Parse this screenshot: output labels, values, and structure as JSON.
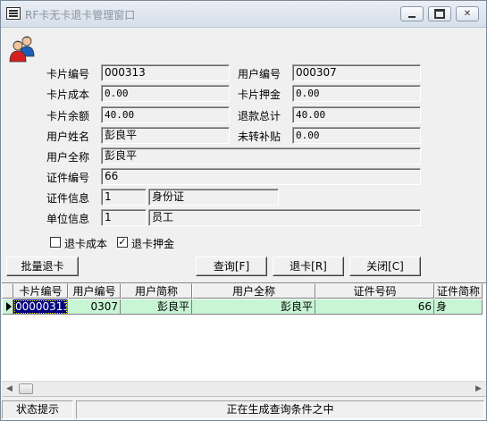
{
  "window": {
    "title": "RF卡无卡退卡管理窗口"
  },
  "icons": {
    "app": "window-menu-icon",
    "users": "users-icon"
  },
  "form": {
    "card_no_label": "卡片编号",
    "card_no": "000313",
    "user_no_label": "用户编号",
    "user_no": "000307",
    "card_cost_label": "卡片成本",
    "card_cost": "0.00",
    "card_deposit_label": "卡片押金",
    "card_deposit": "0.00",
    "card_balance_label": "卡片余额",
    "card_balance": "40.00",
    "refund_total_label": "退款总计",
    "refund_total": "40.00",
    "user_name_label": "用户姓名",
    "user_name": "彭良平",
    "untransferred_label": "未转补贴",
    "untransferred": "0.00",
    "full_name_label": "用户全称",
    "full_name": "彭良平",
    "id_no_label": "证件编号",
    "id_no": "66",
    "id_info_label": "证件信息",
    "id_info_code": "1",
    "id_info_name": "身份证",
    "unit_info_label": "单位信息",
    "unit_info_code": "1",
    "unit_info_name": "员工"
  },
  "options": {
    "refund_cost_label": "退卡成本",
    "refund_cost_checked": false,
    "refund_deposit_label": "退卡押金",
    "refund_deposit_checked": true
  },
  "buttons": {
    "batch_refund": "批量退卡",
    "query": "查询[F]",
    "refund": "退卡[R]",
    "close": "关闭[C]"
  },
  "table": {
    "columns": [
      "卡片编号",
      "用户编号",
      "用户简称",
      "用户全称",
      "证件号码",
      "证件简称"
    ],
    "rows": [
      [
        "00000313",
        "0307",
        "彭良平",
        "彭良平",
        "66",
        "身"
      ]
    ]
  },
  "status": {
    "label": "状态提示",
    "message": "正在生成查询条件之中"
  }
}
